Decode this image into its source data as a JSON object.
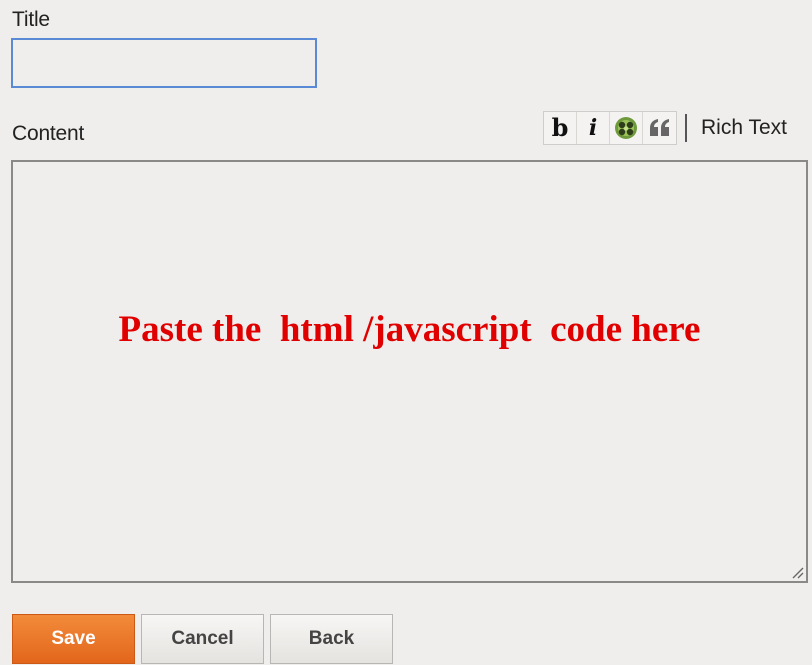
{
  "form": {
    "title_label": "Title",
    "title_value": "",
    "content_label": "Content",
    "content_note": "Paste the  html /javascript  code here"
  },
  "toolbar": {
    "bold_label": "b",
    "italic_label": "i",
    "buttons": [
      {
        "name": "bold",
        "icon": "bold-icon"
      },
      {
        "name": "italic",
        "icon": "italic-icon"
      },
      {
        "name": "image",
        "icon": "image-icon"
      },
      {
        "name": "quote",
        "icon": "quote-icon"
      }
    ],
    "mode_label": "Rich Text"
  },
  "actions": {
    "save_label": "Save",
    "cancel_label": "Cancel",
    "back_label": "Back"
  },
  "colors": {
    "accent": "#e2661c",
    "focus_border": "#5a8ad6",
    "note_text": "#e00000",
    "background": "#efeeec"
  }
}
